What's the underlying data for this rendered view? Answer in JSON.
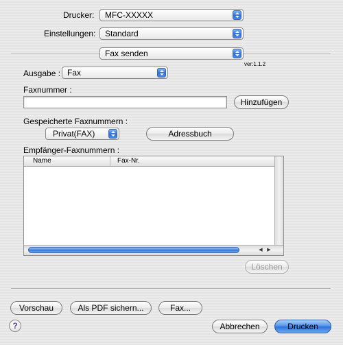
{
  "printer": {
    "label": "Drucker:",
    "value": "MFC-XXXXX"
  },
  "presets": {
    "label": "Einstellungen:",
    "value": "Standard"
  },
  "panel": {
    "value": "Fax senden",
    "version": "ver:1.1.2"
  },
  "output": {
    "label": "Ausgabe :",
    "value": "Fax"
  },
  "faxnumber": {
    "label": "Faxnummer :",
    "value": "",
    "add_button": "Hinzufügen"
  },
  "saved": {
    "label": "Gespeicherte Faxnummern :",
    "value": "Privat(FAX)",
    "addressbook_button": "Adressbuch"
  },
  "recipients": {
    "label": "Empfänger-Faxnummern :",
    "columns": [
      "Name",
      "Fax-Nr."
    ],
    "rows": [],
    "delete_button": "Löschen"
  },
  "footer": {
    "preview_button": "Vorschau",
    "pdf_button": "Als PDF sichern...",
    "fax_button": "Fax...",
    "help": "?",
    "cancel_button": "Abbrechen",
    "print_button": "Drucken"
  },
  "colors": {
    "accent": "#3a7be0",
    "background": "#e8e8e8"
  }
}
